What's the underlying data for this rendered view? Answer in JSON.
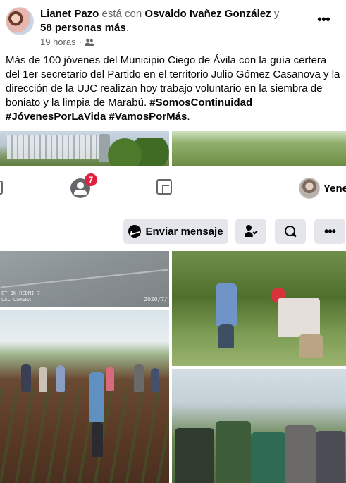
{
  "post": {
    "author": "Lianet Pazo",
    "with_text": "está con",
    "tagged_person": "Osvaldo Ivañez González",
    "and_text": "y",
    "others": "58 personas más",
    "period": ".",
    "time": "19 horas",
    "separator": "·",
    "audience_icon": "friends-icon",
    "more_label": "•••",
    "text_body": "Más de 100 jóvenes del Municipio Ciego de Ávila con la guía certera del 1er secretario del Partido en el territorio Julio Gómez Casanova y la dirección de la UJC  realizan hoy trabajo voluntario en la siembra de boniato y la limpia de Marabú.",
    "hashtags": [
      "#SomosContinuidad",
      "#JóvenesPorLaVida",
      "#VamosPorMás"
    ],
    "hashtag_end": "."
  },
  "nav": {
    "groups_badge": "7",
    "profile_name": "Yene"
  },
  "actions": {
    "send_message_label": "Enviar mensaje",
    "more_label": "•••"
  },
  "photos": {
    "watermark_line1": "OT ON REDMI 7",
    "watermark_line2": "UAL CAMERA",
    "date_stamp": "2020/7/"
  }
}
